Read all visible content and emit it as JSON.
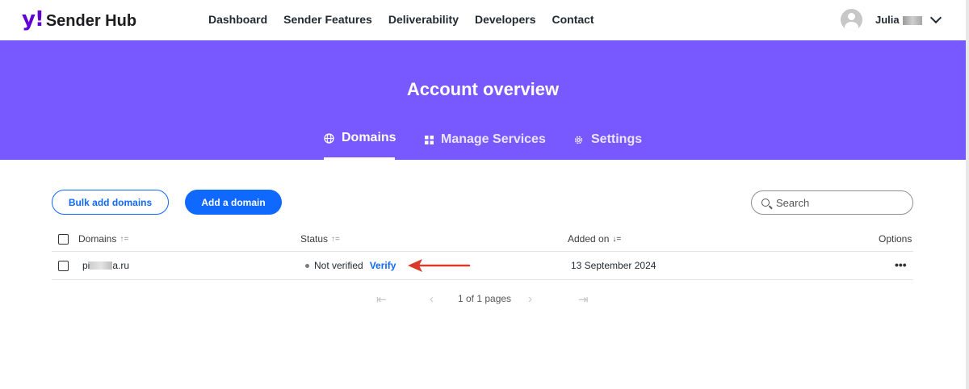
{
  "header": {
    "logo_y": "y!",
    "logo_text": "Sender Hub",
    "nav": [
      "Dashboard",
      "Sender Features",
      "Deliverability",
      "Developers",
      "Contact"
    ],
    "user_name": "Julia"
  },
  "hero": {
    "title": "Account overview",
    "tabs": [
      {
        "label": "Domains",
        "icon": "globe-icon",
        "active": true
      },
      {
        "label": "Manage Services",
        "icon": "grid-icon",
        "active": false
      },
      {
        "label": "Settings",
        "icon": "gear-icon",
        "active": false
      }
    ]
  },
  "toolbar": {
    "bulk_add_label": "Bulk add domains",
    "add_domain_label": "Add a domain",
    "search_placeholder": "Search"
  },
  "table": {
    "columns": {
      "domains": "Domains",
      "status": "Status",
      "added_on": "Added on",
      "options": "Options"
    },
    "rows": [
      {
        "domain_prefix": "pi",
        "domain_suffix": "a.ru",
        "status": "Not verified",
        "action": "Verify",
        "added_on": "13 September 2024",
        "options": "•••"
      }
    ]
  },
  "pagination": {
    "label": "1 of 1 pages"
  },
  "colors": {
    "brand_purple": "#7759ff",
    "accent_blue": "#0f69ff",
    "annotation_red": "#d93a2b"
  }
}
